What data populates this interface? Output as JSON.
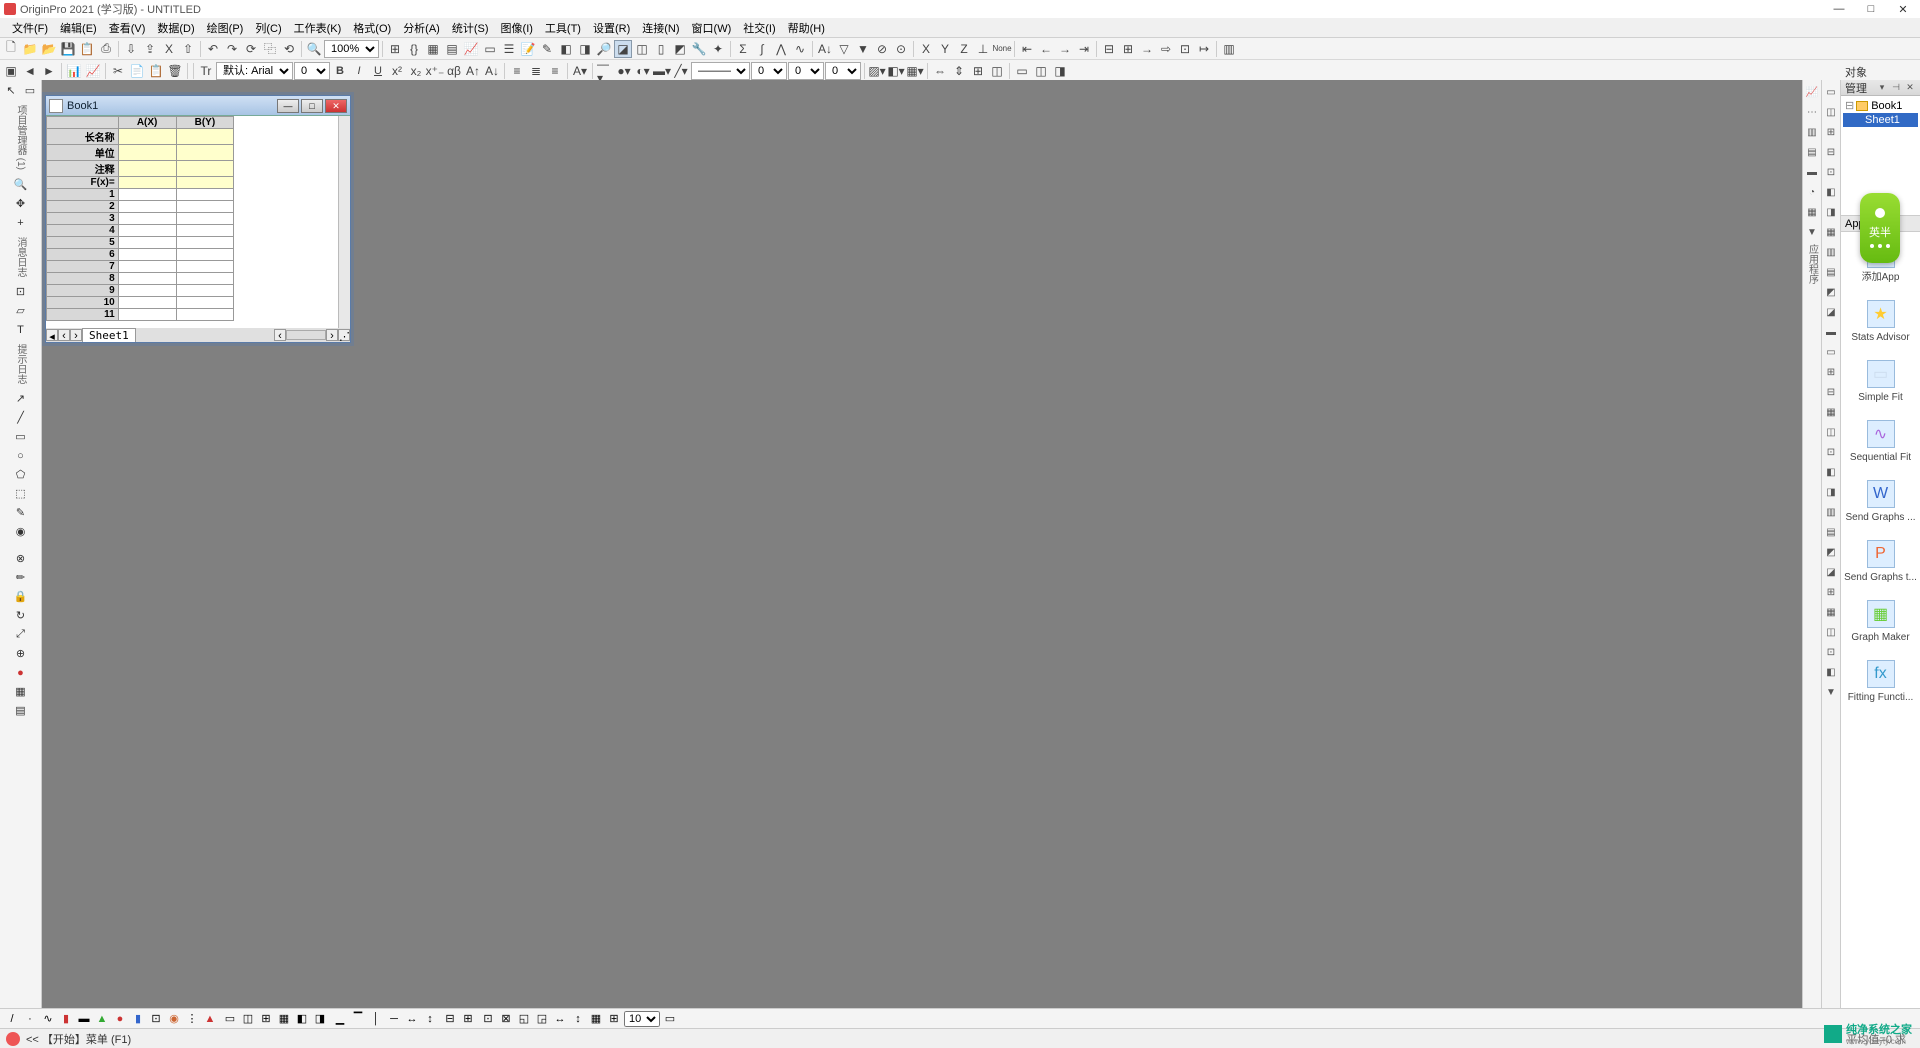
{
  "title": "OriginPro 2021 (学习版) - UNTITLED",
  "menus": [
    "文件(F)",
    "编辑(E)",
    "查看(V)",
    "数据(D)",
    "绘图(P)",
    "列(C)",
    "工作表(K)",
    "格式(O)",
    "分析(A)",
    "统计(S)",
    "图像(I)",
    "工具(T)",
    "设置(R)",
    "连接(N)",
    "窗口(W)",
    "社交(I)",
    "帮助(H)"
  ],
  "zoom": "100%",
  "font_label": "默认: Arial",
  "font_size": "0",
  "opacity1": "0",
  "opacity2": "0",
  "opacity3": "0",
  "childwin": {
    "title": "Book1",
    "cols": [
      "A(X)",
      "B(Y)"
    ],
    "row_headers": [
      "长名称",
      "单位",
      "注释",
      "F(x)="
    ],
    "num_rows": 11,
    "sheet_tab": "Sheet1"
  },
  "objmgr": {
    "title": "对象管理器",
    "book": "Book1",
    "sheet": "Sheet1"
  },
  "apps_title": "Apps",
  "apps": [
    {
      "icon": "＋",
      "label": "添加App",
      "color": "#3c3"
    },
    {
      "icon": "★",
      "label": "Stats Advisor",
      "color": "#fc3"
    },
    {
      "icon": "▭",
      "label": "Simple Fit",
      "color": "#cde"
    },
    {
      "icon": "∿",
      "label": "Sequential Fit",
      "color": "#a6d"
    },
    {
      "icon": "W",
      "label": "Send Graphs ...",
      "color": "#36c"
    },
    {
      "icon": "P",
      "label": "Send Graphs t...",
      "color": "#e63"
    },
    {
      "icon": "▦",
      "label": "Graph Maker",
      "color": "#6c3"
    },
    {
      "icon": "fx",
      "label": "Fitting Functi...",
      "color": "#39c"
    }
  ],
  "status_left": "<<  【开始】菜单 (F1)",
  "status_right": "平均值=0 求",
  "bottom_linesize": "10",
  "watermark_text": "纯净系统之家",
  "watermark_sub": "www.ycwyty.com",
  "ime_text": "英半",
  "left_labels": {
    "a": "项目管理器 (1)",
    "b": "消息日志",
    "c": "提示日志"
  }
}
